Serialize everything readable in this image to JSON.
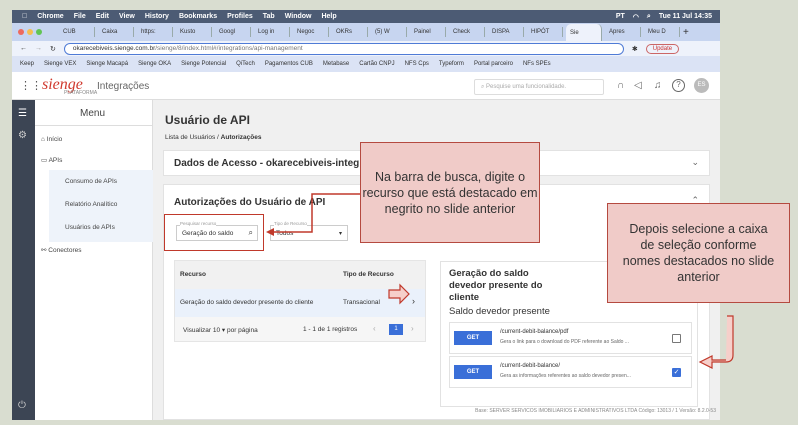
{
  "menubar": {
    "apple": "",
    "items": [
      "Chrome",
      "File",
      "Edit",
      "View",
      "History",
      "Bookmarks",
      "Profiles",
      "Tab",
      "Window",
      "Help"
    ],
    "lang": "PT",
    "datetime": "Tue 11 Jul 14:35"
  },
  "tabs": [
    "CUB",
    "Caixa",
    "https:",
    "Kusto",
    "Googl",
    "Log in",
    "Negoc",
    "OKRs",
    "(5) W",
    "Painel",
    "Check",
    "DISPA",
    "HIPÓT",
    "Sie",
    "Apres",
    "Meu D"
  ],
  "address": {
    "host": "okarecebiveis.sienge.com.br",
    "path": "/sienge/8/index.html#/integrations/api-management",
    "update": "Update"
  },
  "bookmarks": [
    "Keep",
    "Sienge VEX",
    "Sienge Macapá",
    "Sienge OKA",
    "Sienge Potencial",
    "QiTech",
    "Pagamentos CUB",
    "Metabase",
    "Cartão CNPJ",
    "NFS Cps",
    "Typeform",
    "Portal parceiro",
    "NFs SPEs"
  ],
  "app": {
    "logo": "sienge",
    "logo_sub": "PLATAFORMA",
    "title": "Integrações",
    "search_placeholder": "Pesquise uma funcionalidade.",
    "avatar": "ES"
  },
  "sidebar": {
    "title": "Menu",
    "items": [
      "Início",
      "APIs",
      "Consumo de APIs",
      "Relatório Analítico",
      "Usuários de APIs",
      "Conectores"
    ]
  },
  "main": {
    "title": "Usuário de API",
    "breadcrumb": [
      "Lista de Usuários",
      "Autorizações"
    ],
    "access_title": "Dados de Acesso - okarecebiveis-integ",
    "auth_title": "Autorizações do Usuário de API",
    "search_label": "Pesquisar recurso",
    "search_value": "Geração do saldo",
    "type_label": "Tipo de Recurso",
    "type_value": "Todos",
    "table": {
      "headers": [
        "Recurso",
        "Tipo de Recurso"
      ],
      "rows": [
        [
          "Geração do saldo devedor presente do cliente",
          "Transacional"
        ]
      ]
    },
    "pagination": {
      "view": "Visualizar",
      "per_page": "10",
      "per_page_label": "por página",
      "range": "1 - 1 de 1 registros",
      "page": "1"
    },
    "detail": {
      "title": "Geração do saldo devedor presente do cliente",
      "subtitle": "Saldo devedor presente",
      "endpoints": [
        {
          "method": "GET",
          "path": "/current-debit-balance/pdf",
          "desc": "Gera o link para o download do PDF referente ao Saldo ...",
          "checked": false
        },
        {
          "method": "GET",
          "path": "/current-debit-balance/",
          "desc": "Gera as informações referentes ao saldo devedor presen...",
          "checked": true
        }
      ]
    },
    "footer": "Base: SERVER SERVICOS IMOBILIARIOS E ADMINISTRATIVOS LTDA  Código: 13013 / 1  Versão: 8.2.0-53"
  },
  "callouts": [
    "Na barra de busca, digite o recurso que está destacado em negrito no slide anterior",
    "Depois selecione a caixa de seleção conforme nomes destacados no slide anterior"
  ],
  "colors": {
    "accent": "#3a6fd8",
    "callout": "#f0cbc8",
    "callout_border": "#b54a40",
    "brand": "#d03a2f"
  }
}
